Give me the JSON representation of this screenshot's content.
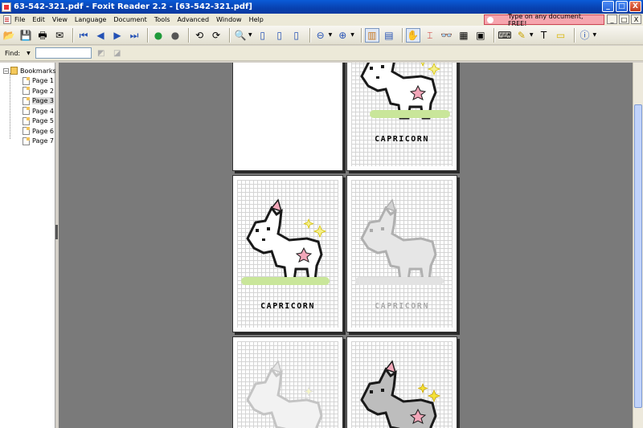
{
  "window": {
    "title": "63-542-321.pdf - Foxit Reader 2.2 - [63-542-321.pdf]",
    "buttons": [
      "_",
      "□",
      "X"
    ]
  },
  "menubar": {
    "items": [
      "File",
      "Edit",
      "View",
      "Language",
      "Document",
      "Tools",
      "Advanced",
      "Window",
      "Help"
    ],
    "promo": "Type on any document, FREE!",
    "mdi_buttons": [
      "_",
      "□",
      "X"
    ]
  },
  "toolbar": {
    "icons": [
      "open-icon",
      "save-icon",
      "print-icon",
      "email-icon",
      "first-page-icon",
      "prev-page-icon",
      "next-page-icon",
      "last-page-icon",
      "go-back-icon",
      "go-forward-icon",
      "rotate-ccw-icon",
      "rotate-cw-icon",
      "zoom-icon",
      "actual-size-icon",
      "fit-page-icon",
      "fit-width-icon",
      "zoom-out-icon",
      "zoom-in-icon",
      "single-page-icon",
      "continuous-icon",
      "hand-tool-icon",
      "select-text-icon",
      "find-icon",
      "snapshot-icon",
      "comments-icon",
      "typewriter-icon",
      "highlight-icon",
      "text-icon",
      "note-icon",
      "info-icon"
    ]
  },
  "findbar": {
    "label": "Find:",
    "value": ""
  },
  "sidebar": {
    "root": "Bookmarks",
    "items": [
      "Page 1",
      "Page 2",
      "Page 3",
      "Page 4",
      "Page 5",
      "Page 6",
      "Page 7"
    ],
    "selected_index": 2
  },
  "document": {
    "page_label": "CAPRICORN",
    "colors": {
      "outline": "#1a1a1a",
      "horn": "#f3a7b9",
      "grass": "#c9e69a",
      "star": "#f4f08e"
    }
  }
}
